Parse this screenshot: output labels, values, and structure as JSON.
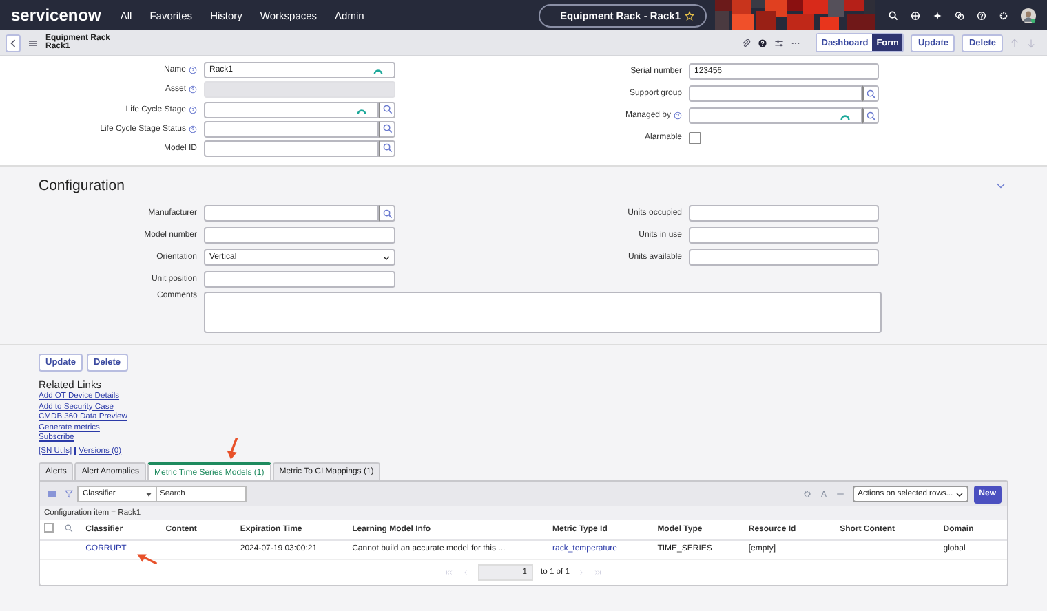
{
  "nav": {
    "logo": "servicenow",
    "menu": [
      "All",
      "Favorites",
      "History",
      "Workspaces",
      "Admin"
    ],
    "title": "Equipment Rack - Rack1"
  },
  "header": {
    "table": "Equipment Rack",
    "record": "Rack1",
    "views": [
      {
        "label": "Dashboard",
        "selected": false
      },
      {
        "label": "Form",
        "selected": true
      }
    ],
    "buttons": [
      "Update",
      "Delete"
    ]
  },
  "form": {
    "left": [
      {
        "label": "Name",
        "help": true,
        "kind": "text",
        "value": "Rack1",
        "busy": true
      },
      {
        "label": "Asset",
        "help": true,
        "kind": "readonly"
      },
      {
        "label": "Life Cycle Stage",
        "help": true,
        "kind": "reference",
        "busy": true
      },
      {
        "label": "Life Cycle Stage Status",
        "help": true,
        "kind": "reference"
      },
      {
        "label": "Model ID",
        "help": false,
        "kind": "reference"
      }
    ],
    "right": [
      {
        "label": "Serial number",
        "help": false,
        "kind": "text",
        "value": "123456"
      },
      {
        "label": "Support group",
        "help": false,
        "kind": "reference"
      },
      {
        "label": "Managed by",
        "help": true,
        "kind": "reference",
        "busy": true
      },
      {
        "label": "Alarmable",
        "help": false,
        "kind": "checkbox",
        "checked": false
      }
    ]
  },
  "configuration": {
    "title": "Configuration",
    "left": [
      {
        "label": "Manufacturer",
        "kind": "reference"
      },
      {
        "label": "Model number",
        "kind": "text"
      },
      {
        "label": "Orientation",
        "kind": "select",
        "value": "Vertical"
      },
      {
        "label": "Unit position",
        "kind": "text"
      }
    ],
    "right": [
      {
        "label": "Units occupied",
        "kind": "text"
      },
      {
        "label": "Units in use",
        "kind": "text"
      },
      {
        "label": "Units available",
        "kind": "text"
      }
    ],
    "comments": {
      "label": "Comments"
    }
  },
  "buttons": [
    "Update",
    "Delete"
  ],
  "related_links": {
    "title": "Related Links",
    "links": [
      "Add OT Device Details",
      "Add to Security Case",
      "CMDB 360 Data Preview",
      "Generate metrics",
      "Subscribe"
    ],
    "last_line": [
      "[SN Utils]",
      "Versions (0)"
    ]
  },
  "tabs": [
    {
      "label": "Alerts",
      "selected": false
    },
    {
      "label": "Alert Anomalies",
      "selected": false
    },
    {
      "label": "Metric Time Series Models (1)",
      "selected": true
    },
    {
      "label": "Metric To CI Mappings (1)",
      "selected": false
    }
  ],
  "list": {
    "select_all": {
      "checked": false
    },
    "search_field": "Classifier",
    "search": {
      "placeholder": "Search"
    },
    "actions": "Actions on selected rows...",
    "new_button": "New",
    "breadcrumb": "Configuration item = Rack1",
    "columns": [
      "Classifier",
      "Content",
      "Expiration Time",
      "Learning Model Info",
      "Metric Type Id",
      "Model Type",
      "Resource Id",
      "Short Content",
      "Domain"
    ],
    "rows": [
      {
        "cells": [
          {
            "text": "CORRUPT",
            "link": true
          },
          {},
          {
            "text": "2024-07-19 03:00:21",
            "link": false
          },
          {
            "text": "Cannot build an accurate model for this ...",
            "link": false
          },
          {
            "text": "rack_temperature",
            "link": true
          },
          {
            "text": "TIME_SERIES",
            "link": false
          },
          {
            "text": "[empty]",
            "link": false
          },
          {},
          {
            "text": "global",
            "link": false
          }
        ]
      }
    ],
    "page": "1",
    "range": "to 1 of 1"
  }
}
